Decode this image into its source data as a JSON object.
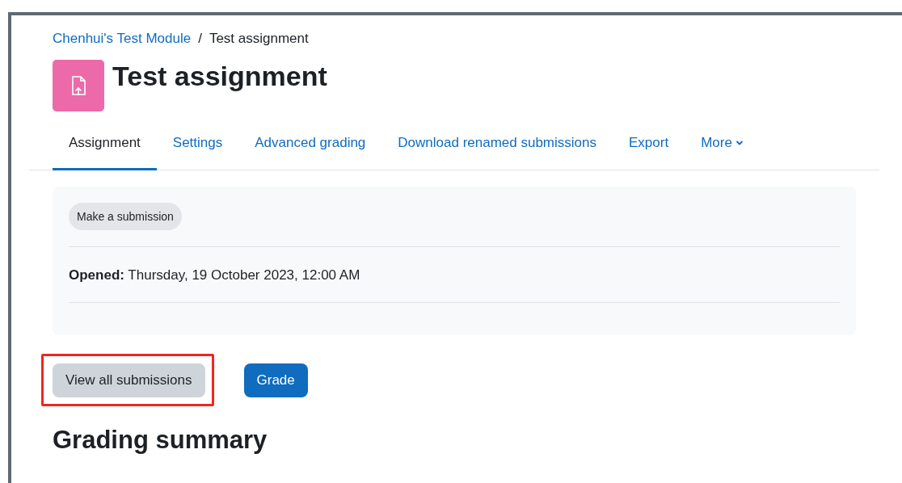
{
  "breadcrumb": [
    {
      "label": "Chenhui's Test Module",
      "kind": "link"
    },
    {
      "label": "Test assignment",
      "kind": "current"
    }
  ],
  "breadcrumb_separator": "/",
  "title": "Test assignment",
  "tabs": [
    {
      "label": "Assignment",
      "selected": true,
      "dropdown": false
    },
    {
      "label": "Settings",
      "selected": false,
      "dropdown": false
    },
    {
      "label": "Advanced grading",
      "selected": false,
      "dropdown": false
    },
    {
      "label": "Download renamed submissions",
      "selected": false,
      "dropdown": false
    },
    {
      "label": "Export",
      "selected": false,
      "dropdown": false
    },
    {
      "label": "More",
      "selected": false,
      "dropdown": true
    }
  ],
  "activity": {
    "badge": "Make a submission",
    "dates": [
      {
        "label": "Opened:",
        "value": "Thursday, 19 October 2023, 12:00 AM"
      }
    ]
  },
  "buttons": [
    {
      "label": "View all submissions",
      "kind": "secondary",
      "highlighted": true
    },
    {
      "label": "Grade",
      "kind": "primary",
      "highlighted": false
    }
  ],
  "section_heading": "Grading summary"
}
